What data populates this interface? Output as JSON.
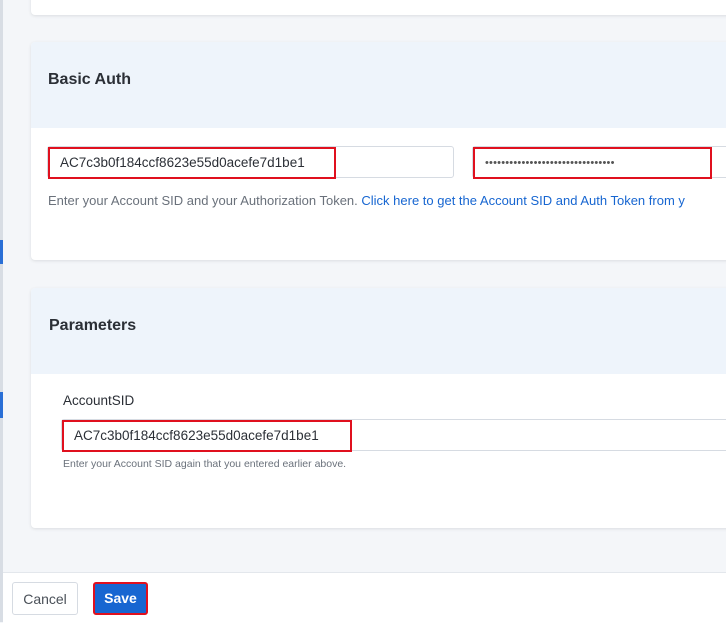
{
  "basic_auth": {
    "title": "Basic Auth",
    "account_sid_value": "AC7c3b0f184ccf8623e55d0acefe7d1be1",
    "auth_token_masked": "••••••••••••••••••••••••••••••••",
    "helper_text": "Enter your Account SID and your Authorization Token. ",
    "helper_link": "Click here to get the Account SID and Auth Token from y"
  },
  "parameters": {
    "title": "Parameters",
    "account_sid_label": "AccountSID",
    "account_sid_value": "AC7c3b0f184ccf8623e55d0acefe7d1be1",
    "account_sid_helper": "Enter your Account SID again that you entered earlier above."
  },
  "footer": {
    "cancel_label": "Cancel",
    "save_label": "Save"
  },
  "colors": {
    "accent": "#1766d1",
    "highlight": "#e0101e",
    "header_bg": "#eef4fb"
  }
}
